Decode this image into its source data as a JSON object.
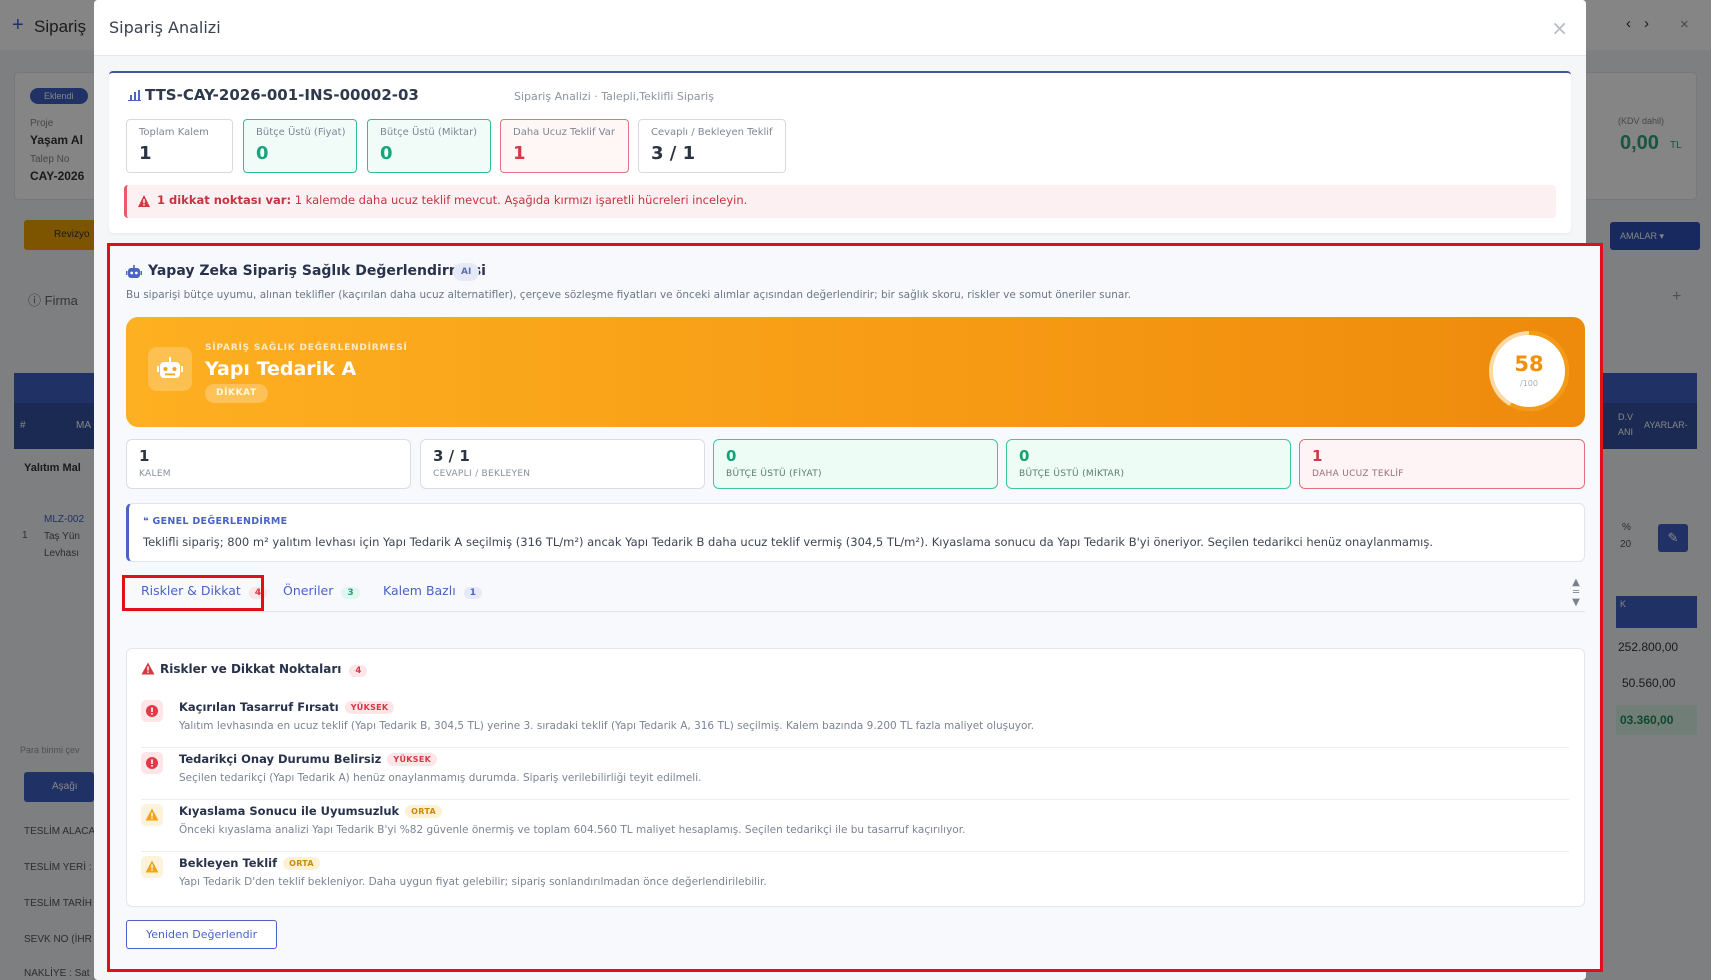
{
  "background": {
    "title": "Sipariş",
    "status_badge": "Eklendi",
    "project_label": "Proje",
    "project_value": "Yaşam Al",
    "request_label": "Talep No",
    "request_value": "CAY-2026",
    "revision_button": "Revizyo",
    "firma": "Firma",
    "total_suffix": "0,00",
    "total_currency": "TL",
    "kdv_label": "(KDV dahil)",
    "actions_button": "AMALAR",
    "table_hash": "#",
    "table_ma": "MA",
    "table_settings": "AYARLAR-",
    "table_dv": "D.V",
    "table_ani": "ANI",
    "group_title": "Yalıtım Mal",
    "row_index": "1",
    "row_code": "MLZ-002",
    "row_name1": "Taş Yün",
    "row_name2": "Levhası",
    "row_pct": "%",
    "row_pct2": "20",
    "row_k": "K",
    "amount1": "252.800,00",
    "amount2": "50.560,00",
    "amount3": "03.360,00",
    "currency_note": "Para birimi çev",
    "download_button": "Aşağı",
    "label_teslim_alaca": "TESLİM ALACA",
    "label_teslim_yeri": "TESLİM YERİ :",
    "label_teslim_tarih": "TESLİM TARİH",
    "label_sevk": "SEVK NO (İHR",
    "label_nakliye": "NAKLİYE : Sat"
  },
  "modal": {
    "title": "Sipariş Analizi",
    "code": "TTS-CAY-2026-001-INS-00002-03",
    "code_sub": "Sipariş Analizi · Talepli,Teklifli Sipariş",
    "summary": [
      {
        "label": "Toplam Kalem",
        "value": "1"
      },
      {
        "label": "Bütçe Üstü (Fiyat)",
        "value": "0"
      },
      {
        "label": "Bütçe Üstü (Miktar)",
        "value": "0"
      },
      {
        "label": "Daha Ucuz Teklif Var",
        "value": "1"
      },
      {
        "label": "Cevaplı / Bekleyen Teklif",
        "value": "3 / 1"
      }
    ],
    "warning_bold": "1 dikkat noktası var:",
    "warning_text": " 1 kalemde daha ucuz teklif mevcut. Aşağıda kırmızı işaretli hücreleri inceleyin."
  },
  "ai": {
    "title": "Yapay Zeka Sipariş Sağlık Değerlendirmesi",
    "badge": "AI",
    "description": "Bu siparişi bütçe uyumu, alınan teklifler (kaçırılan daha ucuz alternatifler), çerçeve sözleşme fiyatları ve önceki alımlar açısından değerlendirir; bir sağlık skoru, riskler ve somut öneriler sunar.",
    "banner_sub": "SİPARİŞ SAĞLIK DEĞERLENDİRMESİ",
    "banner_name": "Yapı Tedarik A",
    "banner_tag": "DİKKAT",
    "score": "58",
    "score_max": "/100",
    "score_fraction": 0.58,
    "stats": [
      {
        "value": "1",
        "label": "KALEM"
      },
      {
        "value": "3 / 1",
        "label": "CEVAPLI / BEKLEYEN"
      },
      {
        "value": "0",
        "label": "BÜTÇE ÜSTÜ (FİYAT)"
      },
      {
        "value": "0",
        "label": "BÜTÇE ÜSTÜ (MİKTAR)"
      },
      {
        "value": "1",
        "label": "DAHA UCUZ TEKLİF"
      }
    ],
    "general_heading": "GENEL DEĞERLENDİRME",
    "general_text": "Teklifli sipariş; 800 m² yalıtım levhası için Yapı Tedarik A seçilmiş (316 TL/m²) ancak Yapı Tedarik B daha ucuz teklif vermiş (304,5 TL/m²). Kıyaslama sonucu da Yapı Tedarik B'yi öneriyor. Seçilen tedarikci henüz onaylanmamış.",
    "tabs": [
      {
        "label": "Riskler & Dikkat",
        "count": "4"
      },
      {
        "label": "Öneriler",
        "count": "3"
      },
      {
        "label": "Kalem Bazlı",
        "count": "1"
      }
    ],
    "risks_title": "Riskler ve Dikkat Noktaları",
    "risks_count": "4",
    "risks": [
      {
        "title": "Kaçırılan Tasarruf Fırsatı",
        "tag": "YÜKSEK",
        "desc": "Yalıtım levhasında en ucuz teklif (Yapı Tedarik B, 304,5 TL) yerine 3. sıradaki teklif (Yapı Tedarik A, 316 TL) seçilmiş. Kalem bazında 9.200 TL fazla maliyet oluşuyor."
      },
      {
        "title": "Tedarikçi Onay Durumu Belirsiz",
        "tag": "YÜKSEK",
        "desc": "Seçilen tedarikçi (Yapı Tedarik A) henüz onaylanmamış durumda. Sipariş verilebilirliği teyit edilmeli."
      },
      {
        "title": "Kıyaslama Sonucu ile Uyumsuzluk",
        "tag": "ORTA",
        "desc": "Önceki kıyaslama analizi Yapı Tedarik B'yi %82 güvenle önermiş ve toplam 604.560 TL maliyet hesaplamış. Seçilen tedarikçi ile bu tasarruf kaçırılıyor."
      },
      {
        "title": "Bekleyen Teklif",
        "tag": "ORTA",
        "desc": "Yapı Tedarik D'den teklif bekleniyor. Daha uygun fiyat gelebilir; sipariş sonlandırılmadan önce değerlendirilebilir."
      }
    ],
    "reevaluate_button": "Yeniden Değerlendir"
  }
}
